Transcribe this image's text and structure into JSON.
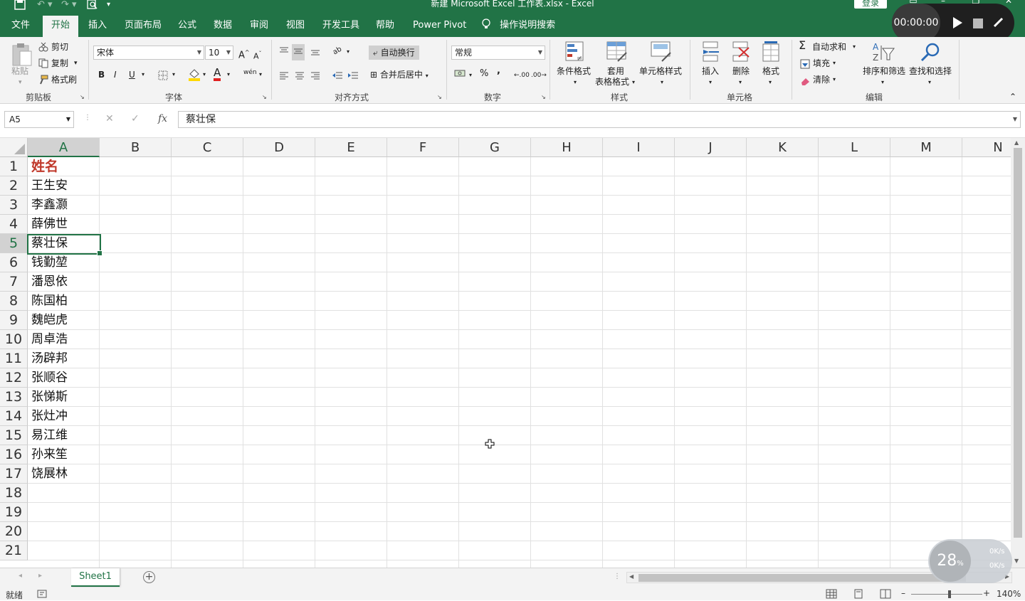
{
  "window": {
    "title": "新建 Microsoft Excel 工作表.xlsx  -  Excel",
    "login": "登录",
    "minimize": "–",
    "restore": "❐",
    "close": "✕"
  },
  "tabs": [
    "文件",
    "开始",
    "插入",
    "页面布局",
    "公式",
    "数据",
    "审阅",
    "视图",
    "开发工具",
    "帮助",
    "Power Pivot"
  ],
  "search_hint": "操作说明搜索",
  "recorder": {
    "time": "00:00:00"
  },
  "ribbon": {
    "clipboard": {
      "paste": "粘贴",
      "cut": "剪切",
      "copy": "复制",
      "painter": "格式刷",
      "group": "剪贴板"
    },
    "font": {
      "name": "宋体",
      "size": "10",
      "bold": "B",
      "italic": "I",
      "underline": "U",
      "group": "字体",
      "grow": "A",
      "shrink": "A",
      "font_color_letter": "A",
      "phonetic": "wén"
    },
    "alignment": {
      "wrap": "自动换行",
      "merge": "合并后居中",
      "group": "对齐方式",
      "orient": "ab"
    },
    "number": {
      "format": "常规",
      "percent": "%",
      "comma": ",",
      "inc_decimal": ".00",
      "dec_decimal": ".00",
      "group": "数字"
    },
    "styles": {
      "conditional": "条件格式",
      "table1": "套用",
      "table2": "表格格式",
      "cell_styles": "单元格样式",
      "group": "样式"
    },
    "cells": {
      "insert": "插入",
      "delete": "删除",
      "format": "格式",
      "group": "单元格"
    },
    "editing": {
      "autosum": "自动求和",
      "fill": "填充",
      "clear": "清除",
      "sort": "排序和筛选",
      "find": "查找和选择",
      "group": "编辑"
    }
  },
  "formula_bar": {
    "name_box": "A5",
    "value": "蔡壮保",
    "cancel": "✕",
    "enter": "✓",
    "fx": "fx"
  },
  "columns": [
    "A",
    "B",
    "C",
    "D",
    "E",
    "F",
    "G",
    "H",
    "I",
    "J",
    "K",
    "L",
    "M",
    "N"
  ],
  "rows": [
    "1",
    "2",
    "3",
    "4",
    "5",
    "6",
    "7",
    "8",
    "9",
    "10",
    "11",
    "12",
    "13",
    "14",
    "15",
    "16",
    "17",
    "18",
    "19",
    "20",
    "21"
  ],
  "cells_a": [
    "姓名",
    "王生安",
    "李鑫灏",
    "薛佛世",
    "蔡壮保",
    "钱勤堃",
    "潘恩依",
    "陈国柏",
    "魏皑虎",
    "周卓浩",
    "汤辟邦",
    "张顺谷",
    "张悌斯",
    "张灶冲",
    "易江维",
    "孙来笙",
    "饶展林"
  ],
  "sheet": {
    "name": "Sheet1",
    "add": "+"
  },
  "status": {
    "ready": "就绪",
    "zoom": "140%",
    "zoom_minus": "–",
    "zoom_plus": "+"
  },
  "network": {
    "percent": "28",
    "up": "0K/s",
    "down": "0K/s"
  }
}
